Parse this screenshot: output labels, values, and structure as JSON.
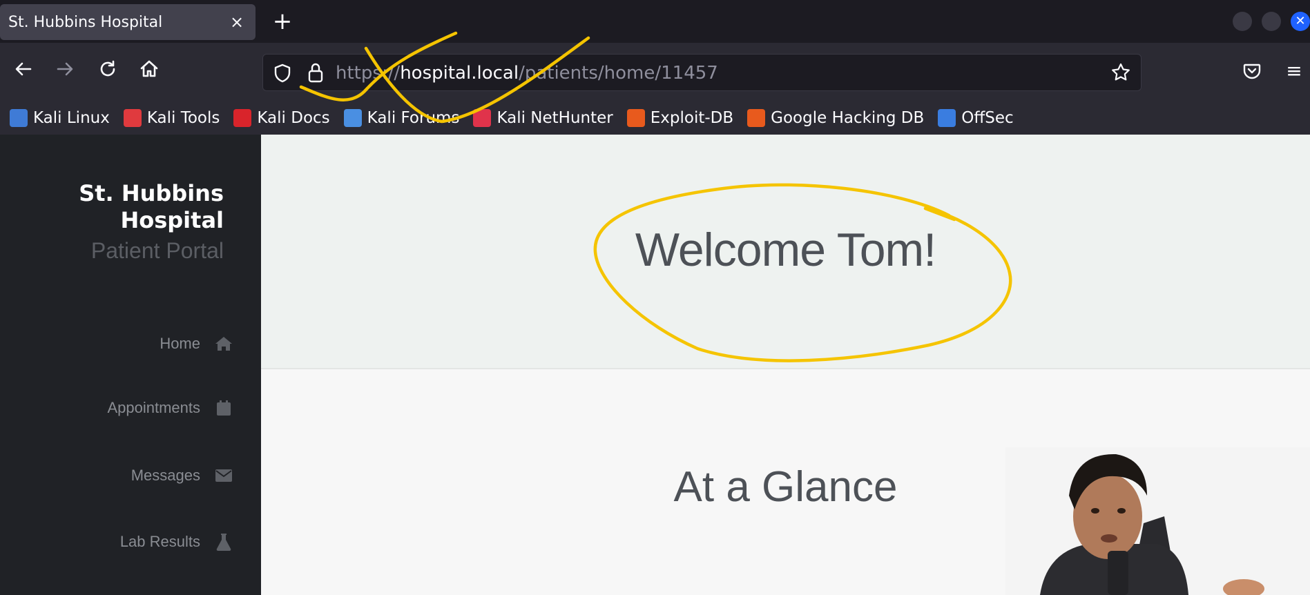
{
  "browser": {
    "tab": {
      "title": "St. Hubbins Hospital"
    },
    "newtab_glyph": "+",
    "close_glyph": "×",
    "url": {
      "scheme_part": "https://",
      "host": "hospital.local",
      "path": "/patients/home/11457"
    },
    "bookmarks": [
      {
        "label": "Kali Linux",
        "icon": "kali-dragon-icon",
        "color": "#3f7bd6"
      },
      {
        "label": "Kali Tools",
        "icon": "kali-tools-icon",
        "color": "#e03a3e"
      },
      {
        "label": "Kali Docs",
        "icon": "kali-docs-icon",
        "color": "#d9242b"
      },
      {
        "label": "Kali Forums",
        "icon": "kali-forums-icon",
        "color": "#4a8fe2"
      },
      {
        "label": "Kali NetHunter",
        "icon": "kali-nethunter-icon",
        "color": "#e0334b"
      },
      {
        "label": "Exploit-DB",
        "icon": "exploit-db-icon",
        "color": "#e85a1d"
      },
      {
        "label": "Google Hacking DB",
        "icon": "ghdb-icon",
        "color": "#e85a1d"
      },
      {
        "label": "OffSec",
        "icon": "offsec-icon",
        "color": "#3a7de0"
      }
    ]
  },
  "sidebar": {
    "brand_line1": "St. Hubbins",
    "brand_line2": "Hospital",
    "brand_sub": "Patient Portal",
    "items": [
      {
        "label": "Home",
        "icon": "home-icon"
      },
      {
        "label": "Appointments",
        "icon": "calendar-icon"
      },
      {
        "label": "Messages",
        "icon": "envelope-icon"
      },
      {
        "label": "Lab Results",
        "icon": "flask-icon"
      }
    ]
  },
  "main": {
    "welcome": "Welcome Tom!",
    "glance": "At a Glance"
  },
  "colors": {
    "annotation": "#f5c400",
    "sidebar_bg": "#202226",
    "hero_bg": "#eef2f0"
  }
}
